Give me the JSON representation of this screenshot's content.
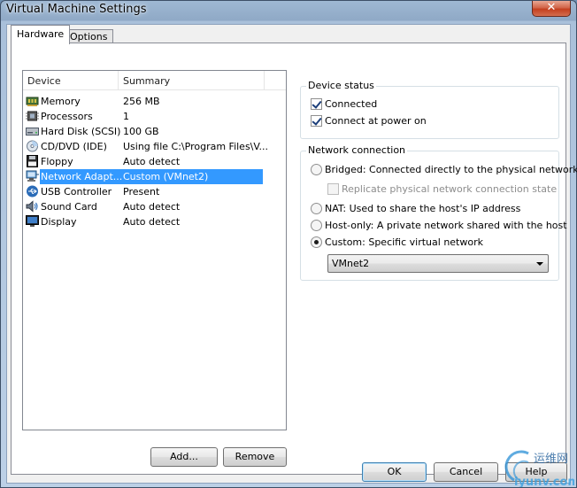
{
  "window": {
    "title": "Virtual Machine Settings",
    "close_label": "✕"
  },
  "tabs": [
    {
      "label": "Hardware",
      "active": true
    },
    {
      "label": "Options",
      "active": false
    }
  ],
  "device_list": {
    "columns": [
      "Device",
      "Summary"
    ],
    "rows": [
      {
        "device": "Memory",
        "summary": "256 MB",
        "icon": "memory-icon"
      },
      {
        "device": "Processors",
        "summary": "1",
        "icon": "processor-icon"
      },
      {
        "device": "Hard Disk (SCSI)",
        "summary": "100 GB",
        "icon": "hard-disk-icon"
      },
      {
        "device": "CD/DVD (IDE)",
        "summary": "Using file C:\\Program Files\\V...",
        "icon": "cd-dvd-icon"
      },
      {
        "device": "Floppy",
        "summary": "Auto detect",
        "icon": "floppy-icon"
      },
      {
        "device": "Network Adapt...",
        "summary": "Custom (VMnet2)",
        "icon": "network-adapter-icon",
        "selected": true
      },
      {
        "device": "USB Controller",
        "summary": "Present",
        "icon": "usb-icon"
      },
      {
        "device": "Sound Card",
        "summary": "Auto detect",
        "icon": "sound-card-icon"
      },
      {
        "device": "Display",
        "summary": "Auto detect",
        "icon": "display-icon"
      }
    ]
  },
  "buttons": {
    "add": "Add...",
    "remove": "Remove",
    "ok": "OK",
    "cancel": "Cancel",
    "help": "Help"
  },
  "device_status": {
    "title": "Device status",
    "connected": {
      "label": "Connected",
      "checked": true
    },
    "connect_at_power_on": {
      "label": "Connect at power on",
      "checked": true
    }
  },
  "network_connection": {
    "title": "Network connection",
    "bridged": "Bridged: Connected directly to the physical network",
    "replicate": "Replicate physical network connection state",
    "nat": "NAT: Used to share the host's IP address",
    "host_only": "Host-only: A private network shared with the host",
    "custom": "Custom: Specific virtual network",
    "selected": "custom",
    "custom_network_value": "VMnet2"
  },
  "watermark": {
    "text_cn": "运维网",
    "text_en": "iyunv.com"
  }
}
